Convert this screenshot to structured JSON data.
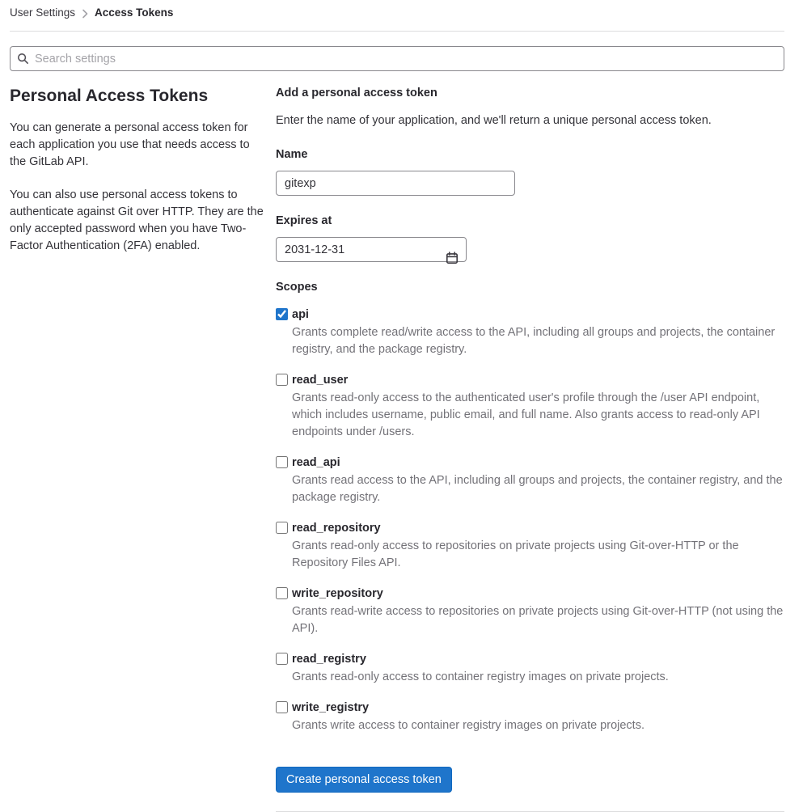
{
  "breadcrumb": {
    "parent": "User Settings",
    "current": "Access Tokens"
  },
  "search": {
    "placeholder": "Search settings"
  },
  "sidebar": {
    "title": "Personal Access Tokens",
    "paragraph1": "You can generate a personal access token for each application you use that needs access to the GitLab API.",
    "paragraph2": "You can also use personal access tokens to authenticate against Git over HTTP. They are the only accepted password when you have Two-Factor Authentication (2FA) enabled."
  },
  "form": {
    "title": "Add a personal access token",
    "description": "Enter the name of your application, and we'll return a unique personal access token.",
    "name_label": "Name",
    "name_value": "gitexp",
    "expires_label": "Expires at",
    "expires_value": "2031-12-31",
    "scopes_label": "Scopes",
    "scopes": [
      {
        "label": "api",
        "checked_attr": "checked",
        "description": "Grants complete read/write access to the API, including all groups and projects, the container registry, and the package registry."
      },
      {
        "label": "read_user",
        "description": "Grants read-only access to the authenticated user's profile through the /user API endpoint, which includes username, public email, and full name. Also grants access to read-only API endpoints under /users."
      },
      {
        "label": "read_api",
        "description": "Grants read access to the API, including all groups and projects, the container registry, and the package registry."
      },
      {
        "label": "read_repository",
        "description": "Grants read-only access to repositories on private projects using Git-over-HTTP or the Repository Files API."
      },
      {
        "label": "write_repository",
        "description": "Grants read-write access to repositories on private projects using Git-over-HTTP (not using the API)."
      },
      {
        "label": "read_registry",
        "description": "Grants read-only access to container registry images on private projects."
      },
      {
        "label": "write_registry",
        "description": "Grants write access to container registry images on private projects."
      }
    ],
    "submit_label": "Create personal access token"
  },
  "icons": {
    "search": "search-icon",
    "calendar": "calendar-icon",
    "breadcrumb_separator": "chevron-right-icon"
  },
  "colors": {
    "accent": "#1f75cb",
    "divider": "#dcdcde",
    "muted_text": "#737278"
  }
}
